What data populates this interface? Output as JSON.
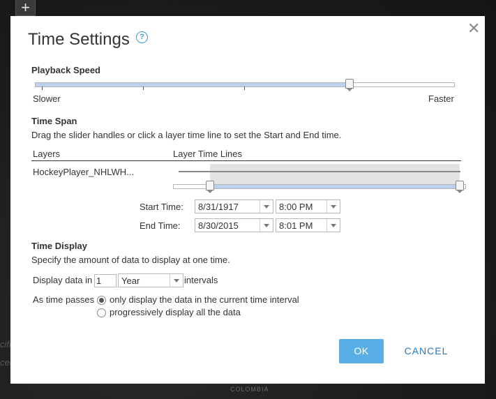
{
  "map": {
    "zoom_in_label": "+",
    "country_label": "COLOMBIA",
    "left_label_1": "cifi",
    "left_label_2": "ceo"
  },
  "dialog": {
    "title": "Time Settings",
    "help_glyph": "?",
    "close_glyph": "✕"
  },
  "playback": {
    "title": "Playback Speed",
    "slower_label": "Slower",
    "faster_label": "Faster",
    "speed_fraction": 0.75
  },
  "time_span": {
    "title": "Time Span",
    "description": "Drag the slider handles or click a layer time line to set the Start and End time.",
    "layers_header": "Layers",
    "timelines_header": "Layer Time Lines",
    "layers": [
      {
        "name": "HockeyPlayer_NHLWH..."
      }
    ],
    "start_label": "Start Time:",
    "start_date": "8/31/1917",
    "start_time": "8:00 PM",
    "end_label": "End Time:",
    "end_date": "8/30/2015",
    "end_time": "8:01 PM"
  },
  "time_display": {
    "title": "Time Display",
    "description": "Specify the amount of data to display at one time.",
    "display_prefix": "Display data in",
    "interval_count": "1",
    "interval_unit": "Year",
    "display_suffix": "intervals",
    "as_time_passes_label": "As time passes",
    "option_current": "only display the data in the current time interval",
    "option_progressive": "progressively display all the data",
    "selected_option": "current"
  },
  "buttons": {
    "ok": "OK",
    "cancel": "CANCEL"
  },
  "colors": {
    "accent": "#5aaee6",
    "link": "#2b78b8",
    "slider_fill": "#bcd1ee"
  }
}
